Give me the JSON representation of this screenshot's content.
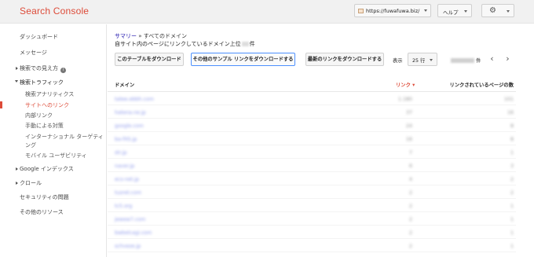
{
  "header": {
    "logo": "Search Console",
    "site": "https://fuwafuwa.biz/",
    "help": "ヘルプ",
    "gear_icon": "gear-icon"
  },
  "sidebar": {
    "items": [
      {
        "label": "ダッシュボード"
      },
      {
        "label": "メッセージ"
      },
      {
        "label": "検索での見え方"
      },
      {
        "label": "検索トラフィック"
      },
      {
        "label": "検索アナリティクス"
      },
      {
        "label": "サイトへのリンク"
      },
      {
        "label": "内部リンク"
      },
      {
        "label": "手動による対策"
      },
      {
        "label": "インターナショナル ターゲティ"
      },
      {
        "label": "ング"
      },
      {
        "label": "モバイル ユーザビリティ"
      },
      {
        "label": "Google インデックス"
      },
      {
        "label": "クロール"
      },
      {
        "label": "セキュリティの問題"
      },
      {
        "label": "その他のリソース"
      }
    ]
  },
  "breadcrumb": {
    "parent": "サマリー",
    "separator": "»",
    "current": "すべてのドメイン"
  },
  "subtitle": {
    "prefix": "自サイト内のページにリンクしているドメイン上位",
    "suffix": "件"
  },
  "toolbar": {
    "download_table": "このテーブルをダウンロード",
    "download_more_links": "その他のサンプル リンクをダウンロードする",
    "download_latest_links": "最新のリンクをダウンロードする",
    "display_label": "表示",
    "rows_value": "25 行",
    "range_suffix": "件"
  },
  "table": {
    "headers": {
      "domain": "ドメイン",
      "links": "リンク ▾",
      "linked_pages": "リンクされているページの数"
    },
    "rows": [
      {
        "domain": "tatee.ebbh.com",
        "links": "1.180",
        "pages": "101"
      },
      {
        "domain": "hatena.ne.jp",
        "links": "37",
        "pages": "16"
      },
      {
        "domain": "google.com",
        "links": "24",
        "pages": "8"
      },
      {
        "domain": "ba-fXS.jp",
        "links": "16",
        "pages": "8"
      },
      {
        "domain": "str.jp",
        "links": "7",
        "pages": "1"
      },
      {
        "domain": "naver.jp",
        "links": "6",
        "pages": "3"
      },
      {
        "domain": "ecs-net.jp",
        "links": "4",
        "pages": "2"
      },
      {
        "domain": "tuzret.com",
        "links": "2",
        "pages": "2"
      },
      {
        "domain": "tc5.org",
        "links": "2",
        "pages": "1"
      },
      {
        "domain": "jewew7.com",
        "links": "2",
        "pages": "1"
      },
      {
        "domain": "bwbelcagi.com",
        "links": "2",
        "pages": "1"
      },
      {
        "domain": "schveze.jp",
        "links": "2",
        "pages": "1"
      }
    ]
  }
}
